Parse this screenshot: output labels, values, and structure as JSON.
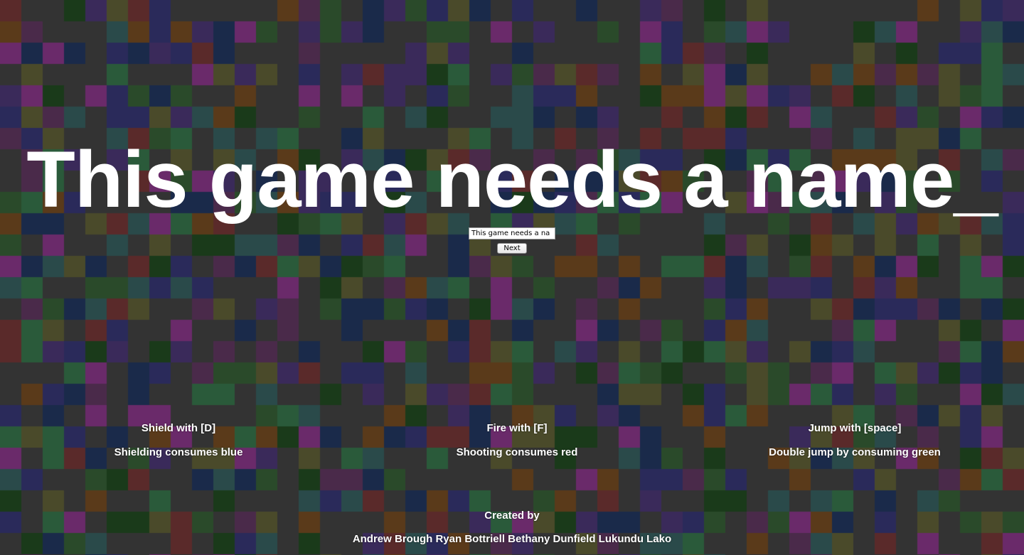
{
  "game": {
    "title": "This game needs a name_",
    "name_input": {
      "value": "This game needs a na",
      "placeholder": ""
    },
    "next_label": "Next"
  },
  "controls": [
    {
      "action": "Shield with [D]",
      "cost": "Shielding consumes blue"
    },
    {
      "action": "Fire with [F]",
      "cost": "Shooting consumes red"
    },
    {
      "action": "Jump with [space]",
      "cost": "Double jump by consuming green"
    }
  ],
  "credits": {
    "heading": "Created by",
    "names": "Andrew Brough Ryan Bottriell Bethany Dunfield Lukundu Lako"
  },
  "palette": {
    "base": "#333333",
    "tints": [
      "#2a4a2a",
      "#4a2a4a",
      "#2a2a5a",
      "#5a2a2a",
      "#2a4a4a",
      "#4a4a2a",
      "#3a2a5a",
      "#1a3a1a",
      "#5a3a1a",
      "#1a2a4a",
      "#6a2a6a",
      "#2a5a3a"
    ]
  }
}
